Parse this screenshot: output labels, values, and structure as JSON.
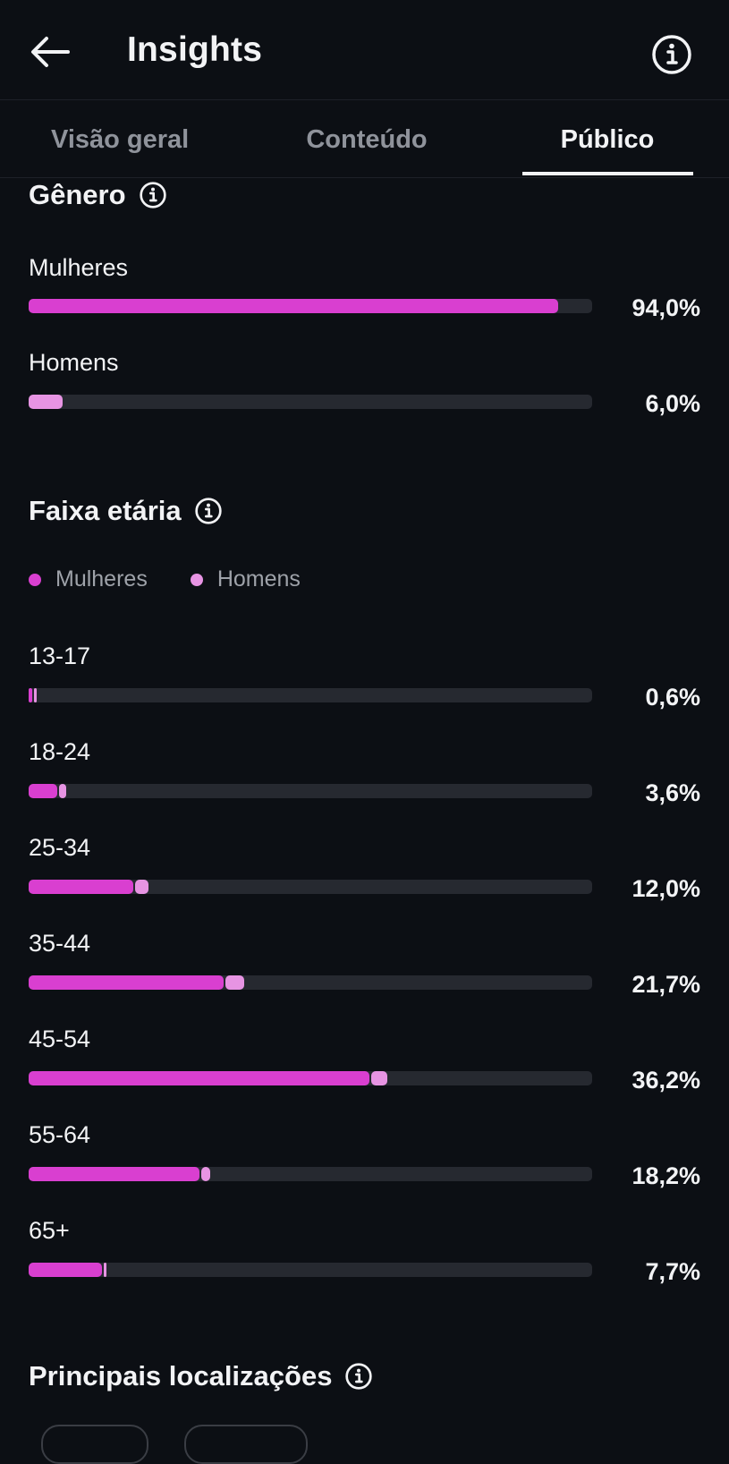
{
  "header": {
    "back_icon": "arrow-left-icon",
    "title": "Insights",
    "info_icon": "info-circle-icon"
  },
  "tabs": [
    {
      "label": "Visão geral",
      "active": false
    },
    {
      "label": "Conteúdo",
      "active": false
    },
    {
      "label": "Público",
      "active": true
    }
  ],
  "colors": {
    "women": "#d93fd0",
    "men": "#e794e3",
    "track": "#262930",
    "background": "#0c0f14"
  },
  "gender": {
    "title": "Gênero",
    "rows": [
      {
        "label": "Mulheres",
        "value": 94.0,
        "text": "94,0%"
      },
      {
        "label": "Homens",
        "value": 6.0,
        "text": "6,0%"
      }
    ]
  },
  "age": {
    "title": "Faixa etária",
    "legend": [
      "Mulheres",
      "Homens"
    ],
    "rows": [
      {
        "label": "13-17",
        "women": 0.4,
        "men": 0.2,
        "text": "0,6%"
      },
      {
        "label": "18-24",
        "women": 2.9,
        "men": 0.7,
        "text": "3,6%"
      },
      {
        "label": "25-34",
        "women": 10.6,
        "men": 1.4,
        "text": "12,0%"
      },
      {
        "label": "35-44",
        "women": 19.8,
        "men": 1.9,
        "text": "21,7%"
      },
      {
        "label": "45-54",
        "women": 34.6,
        "men": 1.6,
        "text": "36,2%"
      },
      {
        "label": "55-64",
        "women": 17.3,
        "men": 0.9,
        "text": "18,2%"
      },
      {
        "label": "65+",
        "women": 7.4,
        "men": 0.3,
        "text": "7,7%"
      }
    ]
  },
  "locations": {
    "title": "Principais localizações"
  }
}
